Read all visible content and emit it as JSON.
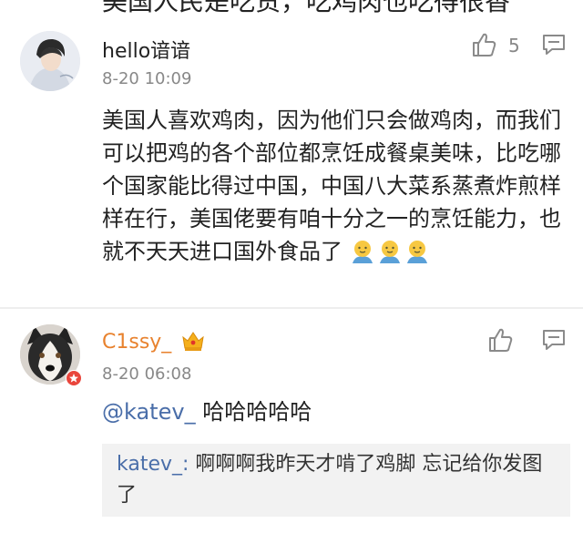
{
  "previous_comment": {
    "cutoff_text": "美国人民是吃货，吃鸡肉也吃得很香"
  },
  "comments": [
    {
      "username": "hello谙谙",
      "time": "8-20 10:09",
      "likes": "5",
      "text": "美国人喜欢鸡肉，因为他们只会做鸡肉，而我们可以把鸡的各个部位都烹饪成餐桌美味，比吃哪个国家能比得过中国，中国八大菜系蒸煮炸煎样样在行，美国佬要有咱十分之一的烹饪能力，也就不天天进口国外食品了",
      "emoji_count": 3
    },
    {
      "username": "C1ssy_",
      "time": "8-20 06:08",
      "mention": "@katev_",
      "reply": " 哈哈哈哈哈",
      "quoted_user": "katev_:",
      "quoted_text": " 啊啊啊我昨天才啃了鸡脚 忘记给你发图了"
    }
  ],
  "colors": {
    "username_vip": "#e8822e",
    "mention": "#4a6ea9",
    "icon_gray": "#8a8a8a",
    "quote_bg": "#f2f2f2"
  },
  "icons": [
    "thumbs-up-icon",
    "reply-icon",
    "crown-icon",
    "vip-badge-icon",
    "emoji-icon"
  ]
}
